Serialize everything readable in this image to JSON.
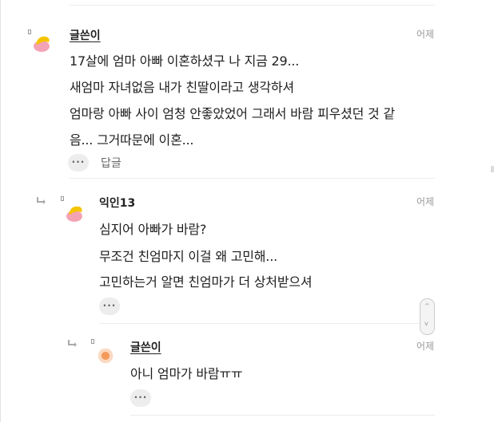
{
  "comments": [
    {
      "author": "글쓴이",
      "time": "어제",
      "lines": [
        "17살에 엄마 아빠 이혼하셨구 나 지금 29...",
        "새엄마 자녀없음 내가 친딸이라고 생각하셔",
        "엄마랑 아빠 사이 엄청 안좋았었어 그래서 바람 피우셨던 것 같",
        "음... 그거따문에 이혼..."
      ],
      "more": "···",
      "reply": "답글"
    },
    {
      "author": "익인13",
      "time": "어제",
      "lines": [
        "심지어 아빠가 바람?",
        "무조건 친엄마지 이걸 왜 고민해...",
        "고민하는거 알면 친엄마가 더 상처받으셔"
      ],
      "more": "···"
    },
    {
      "author": "글쓴이",
      "time": "어제",
      "lines": [
        "아니 엄마가 바람ㅠㅠ"
      ],
      "more": "···"
    }
  ],
  "scroller": {
    "up": "^",
    "down": "v"
  },
  "colors": {
    "avatar_yellow": "#f5c400",
    "avatar_pink": "#f4a3b4",
    "avatar_orange": "#f39a5b"
  }
}
